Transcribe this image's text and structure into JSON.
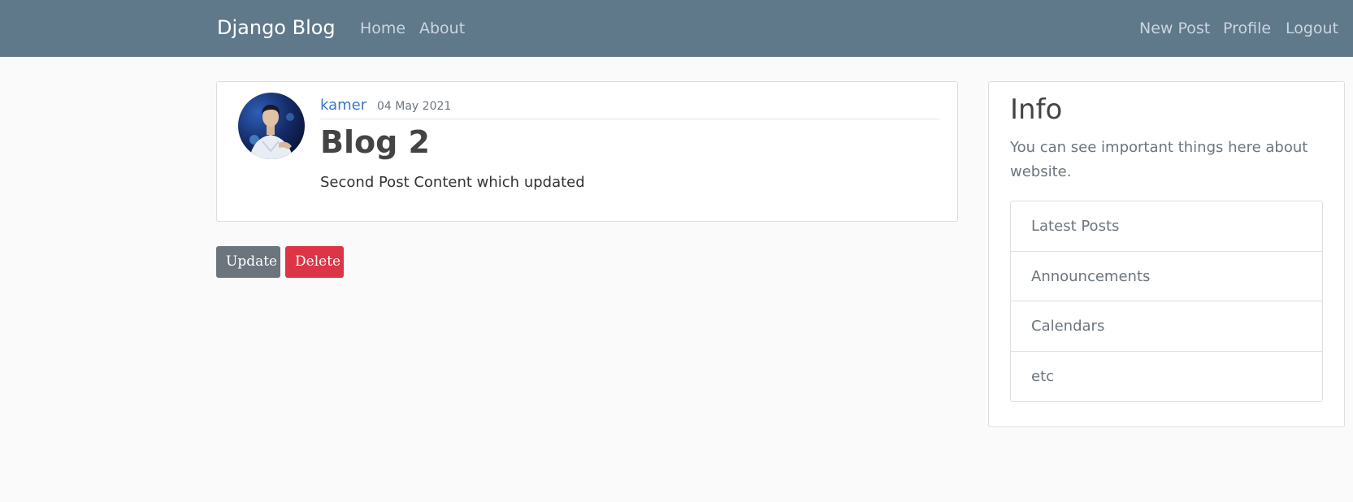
{
  "navbar": {
    "brand": "Django Blog",
    "left_links": [
      "Home",
      "About"
    ],
    "right_links": [
      "New Post",
      "Profile",
      "Logout"
    ]
  },
  "post": {
    "author": "kamer",
    "date": "04 May 2021",
    "title": "Blog 2",
    "content": "Second Post Content which updated"
  },
  "actions": {
    "update_label": "Update",
    "delete_label": "Delete"
  },
  "sidebar": {
    "title": "Info",
    "description": "You can see important things here about website.",
    "items": [
      "Latest Posts",
      "Announcements",
      "Calendars",
      "etc"
    ]
  },
  "colors": {
    "navbar": "#5f788a",
    "author_link": "#3578c8",
    "update_button": "#6c757d",
    "delete_button": "#dc3545"
  }
}
